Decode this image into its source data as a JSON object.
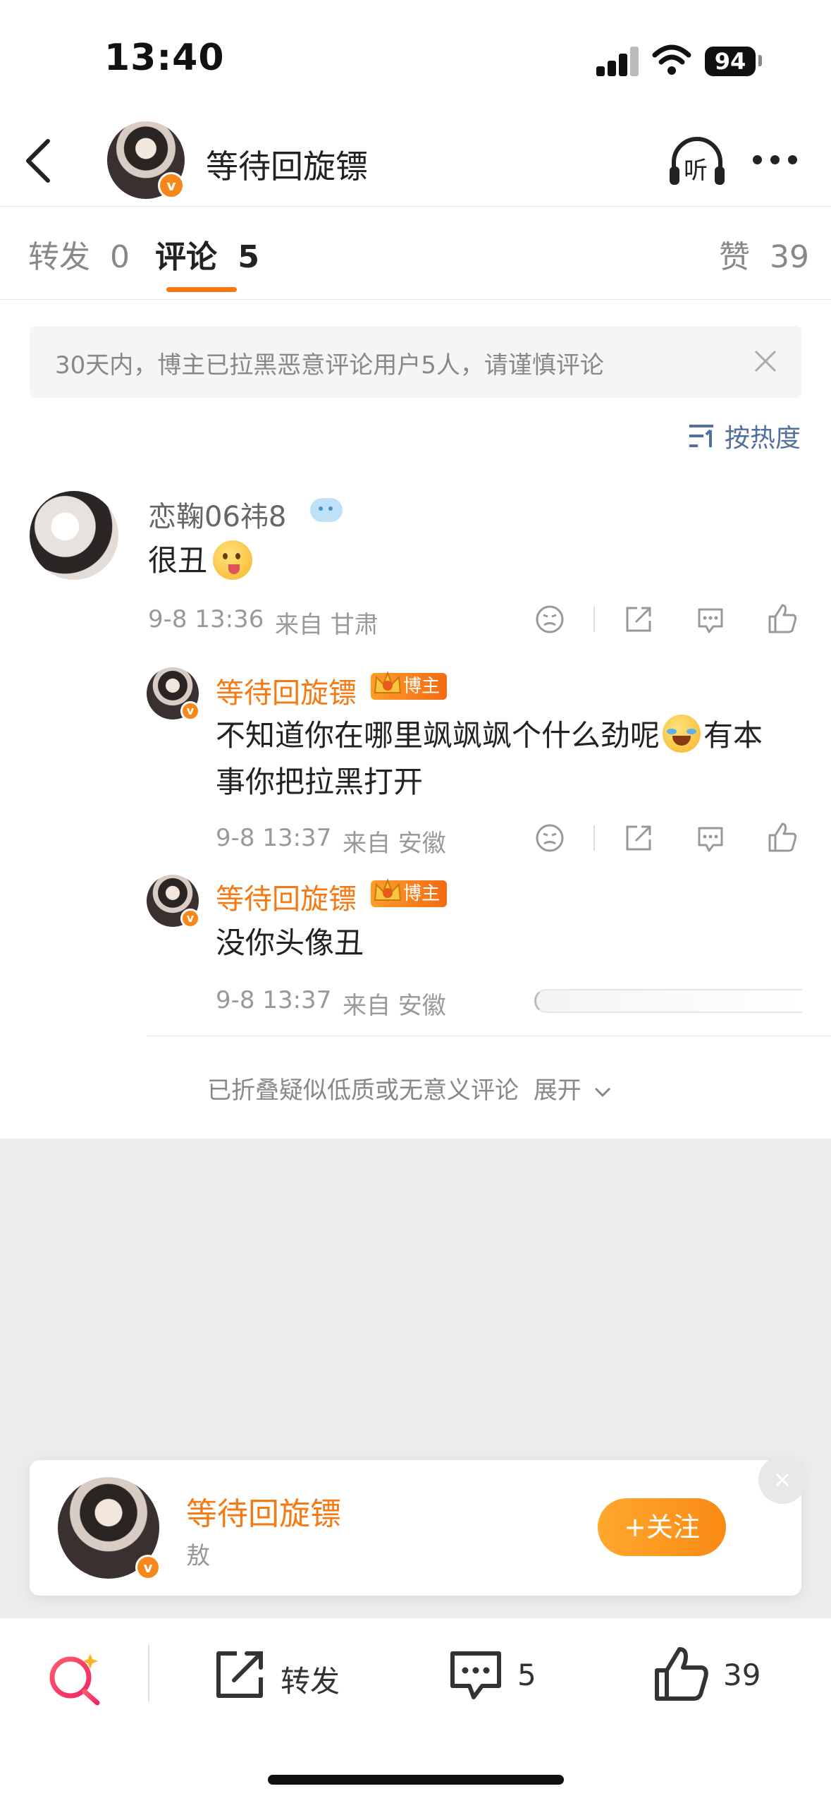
{
  "status_bar": {
    "time": "13:40",
    "battery": "94"
  },
  "header": {
    "title": "等待回旋镖",
    "listen_label": "听"
  },
  "tabs": {
    "repost_label": "转发",
    "repost_count": "0",
    "comment_label": "评论",
    "comment_count": "5",
    "like_label": "赞",
    "like_count": "39"
  },
  "notice": {
    "text": "30天内，博主已拉黑恶意评论用户5人，请谨慎评论"
  },
  "sort": {
    "label": "按热度"
  },
  "comments": [
    {
      "author": "恋鞠06祎8",
      "text": "很丑",
      "time": "9-8 13:36",
      "from": "来自 甘肃",
      "replies": [
        {
          "author": "等待回旋镖",
          "badge": "博主",
          "text_part1": "不知道你在哪里飒飒飒个什么劲呢",
          "text_part2": "有本",
          "text_line2": "事你把拉黑打开",
          "time": "9-8 13:37",
          "from": "来自 安徽"
        },
        {
          "author": "等待回旋镖",
          "badge": "博主",
          "text": "没你头像丑",
          "time": "9-8 13:37",
          "from": "来自 安徽"
        }
      ]
    }
  ],
  "folded": {
    "text": "已折叠疑似低质或无意义评论",
    "expand_label": "展开"
  },
  "follow_card": {
    "name": "等待回旋镖",
    "subtitle": "敖",
    "follow_label": "+关注"
  },
  "bottom_bar": {
    "repost_label": "转发",
    "comment_count": "5",
    "like_count": "39"
  },
  "colors": {
    "accent": "#f57a13",
    "follow_button": "#fb9b1e",
    "grey_bg": "#ececec",
    "notice_bg": "#f5f5f5"
  }
}
